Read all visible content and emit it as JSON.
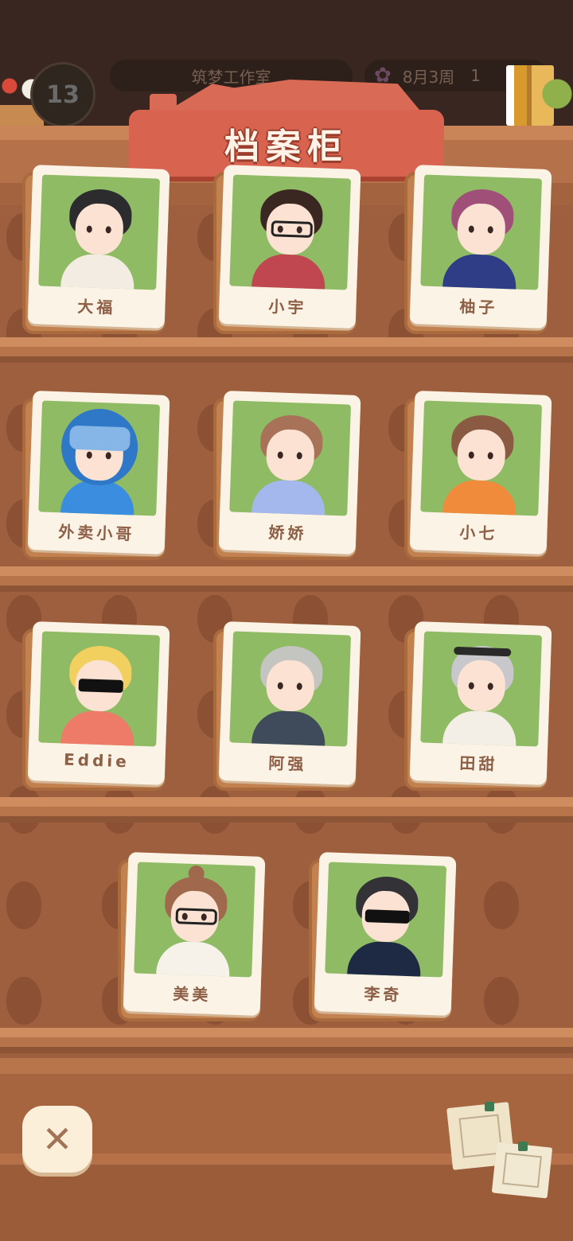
{
  "hud": {
    "level": "13",
    "studio_name": "筑梦工作室",
    "date": "8月3周",
    "date_suffix": "1"
  },
  "header": {
    "title": "档案柜"
  },
  "cards": [
    {
      "name": "大福",
      "hair": "#2c2b2e",
      "shirt": "#f3ece2",
      "accessory": "none"
    },
    {
      "name": "小宇",
      "hair": "#3a2722",
      "shirt": "#c0474f",
      "accessory": "glasses"
    },
    {
      "name": "柚子",
      "hair": "#a05078",
      "shirt": "#2f3c86",
      "accessory": "none"
    },
    {
      "name": "外卖小哥",
      "hair": "#2f78c8",
      "shirt": "#3b8de0",
      "accessory": "helmet"
    },
    {
      "name": "娇娇",
      "hair": "#a87258",
      "shirt": "#a5b8ee",
      "accessory": "none"
    },
    {
      "name": "小七",
      "hair": "#8a5a42",
      "shirt": "#ef8b3a",
      "accessory": "none"
    },
    {
      "name": "Eddie",
      "hair": "#f2d060",
      "shirt": "#ee7a68",
      "accessory": "shades"
    },
    {
      "name": "阿强",
      "hair": "#c4c4c0",
      "shirt": "#3f4a5a",
      "accessory": "none"
    },
    {
      "name": "田甜",
      "hair": "#c8c8cc",
      "shirt": "#f4efe6",
      "accessory": "headband"
    },
    {
      "name": "美美",
      "hair": "#a0684c",
      "shirt": "#f6f2ea",
      "accessory": "glasses-bun"
    },
    {
      "name": "李奇",
      "hair": "#333236",
      "shirt": "#1e2a44",
      "accessory": "shades"
    }
  ],
  "controls": {
    "close_label": "✕"
  }
}
